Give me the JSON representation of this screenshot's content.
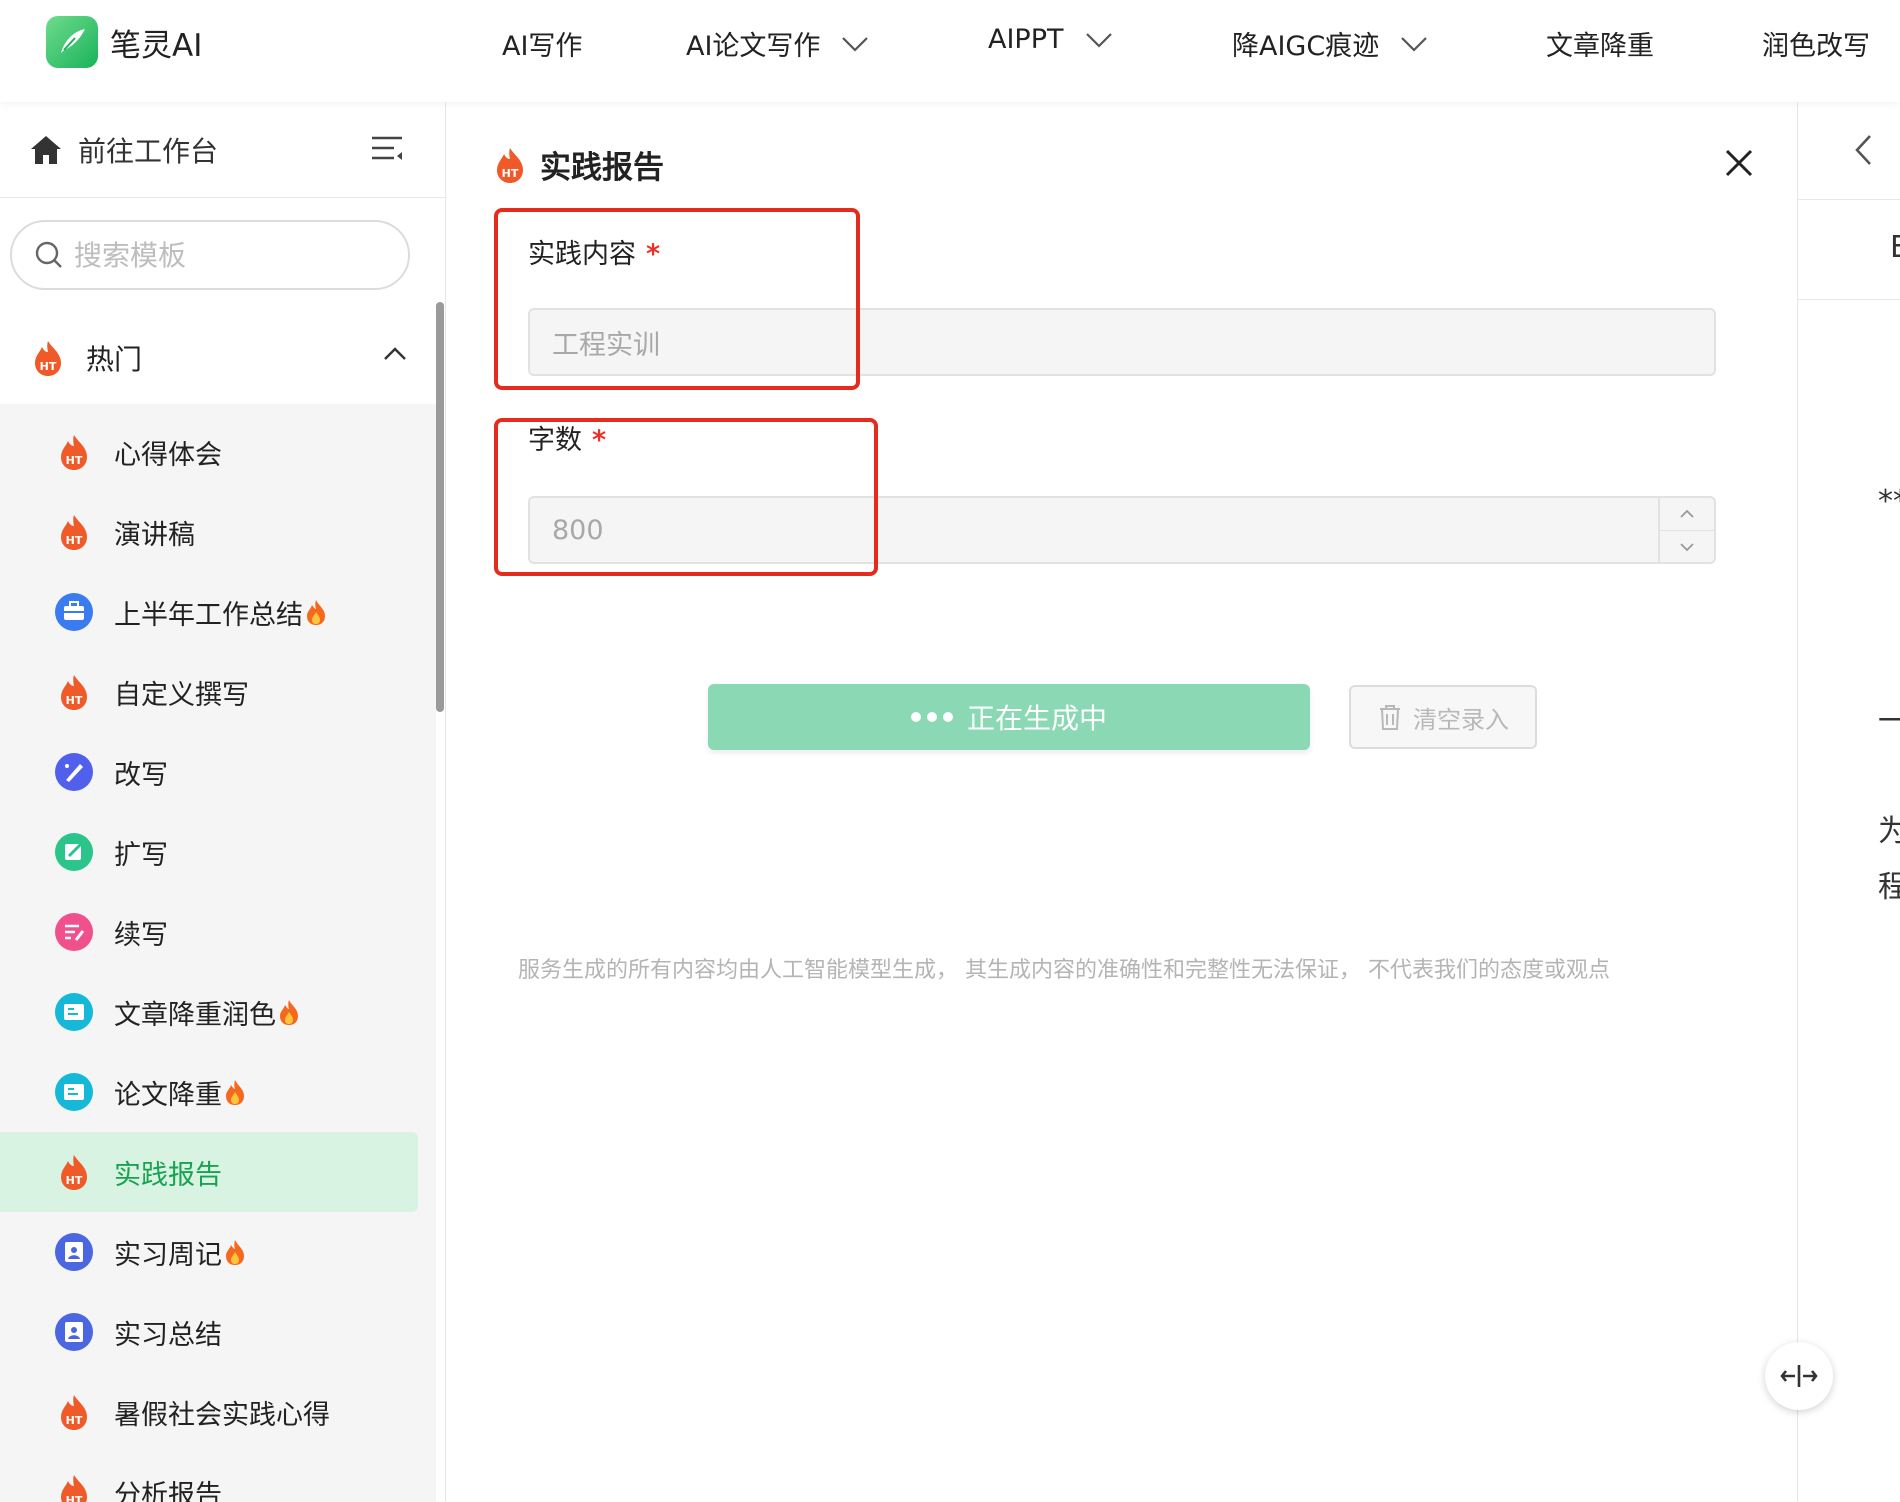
{
  "brand": {
    "name": "笔灵AI"
  },
  "nav": {
    "items": [
      {
        "label": "AI写作",
        "dropdown": false
      },
      {
        "label": "AI论文写作",
        "dropdown": true
      },
      {
        "label": "AIPPT",
        "dropdown": true
      },
      {
        "label": "降AIGC痕迹",
        "dropdown": true
      },
      {
        "label": "文章降重",
        "dropdown": false
      },
      {
        "label": "润色改写",
        "dropdown": false
      }
    ]
  },
  "sidebar": {
    "workbench_label": "前往工作台",
    "search_placeholder": "搜索模板",
    "group_label": "热门",
    "items": [
      {
        "label": "心得体会",
        "icon": "flame-ht-icon",
        "hot": false
      },
      {
        "label": "演讲稿",
        "icon": "flame-ht-icon",
        "hot": false
      },
      {
        "label": "上半年工作总结",
        "icon": "briefcase-icon",
        "hot": true
      },
      {
        "label": "自定义撰写",
        "icon": "flame-ht-icon",
        "hot": false
      },
      {
        "label": "改写",
        "icon": "pen-nib-icon",
        "hot": false
      },
      {
        "label": "扩写",
        "icon": "edit-note-icon",
        "hot": false
      },
      {
        "label": "续写",
        "icon": "continue-write-icon",
        "hot": false
      },
      {
        "label": "文章降重润色",
        "icon": "document-card-icon",
        "hot": true
      },
      {
        "label": "论文降重",
        "icon": "document-card-icon",
        "hot": true
      },
      {
        "label": "实践报告",
        "icon": "flame-ht-icon",
        "hot": false,
        "active": true
      },
      {
        "label": "实习周记",
        "icon": "report-person-icon",
        "hot": true
      },
      {
        "label": "实习总结",
        "icon": "report-person-icon",
        "hot": false
      },
      {
        "label": "暑假社会实践心得",
        "icon": "flame-ht-icon",
        "hot": false
      },
      {
        "label": "分析报告",
        "icon": "flame-ht-icon",
        "hot": false
      }
    ]
  },
  "form": {
    "title": "实践报告",
    "field1": {
      "label": "实践内容",
      "required": "*",
      "value": "工程实训"
    },
    "field2": {
      "label": "字数",
      "required": "*",
      "value": "800"
    },
    "generate_label": "正在生成中",
    "clear_label": "清空录入",
    "disclaimer": "服务生成的所有内容均由人工智能模型生成， 其生成内容的准确性和完整性无法保证， 不代表我们的态度或观点"
  },
  "right": {
    "frag1": "E",
    "frag2": "**",
    "frag3": "一",
    "frag4": "为",
    "frag5": "程"
  },
  "colors": {
    "accent": "#1aa253",
    "active_bg": "#d8f3e1",
    "generate_btn": "#8ad8b4",
    "required": "#e8312a",
    "highlight_box": "#e42b1e"
  }
}
